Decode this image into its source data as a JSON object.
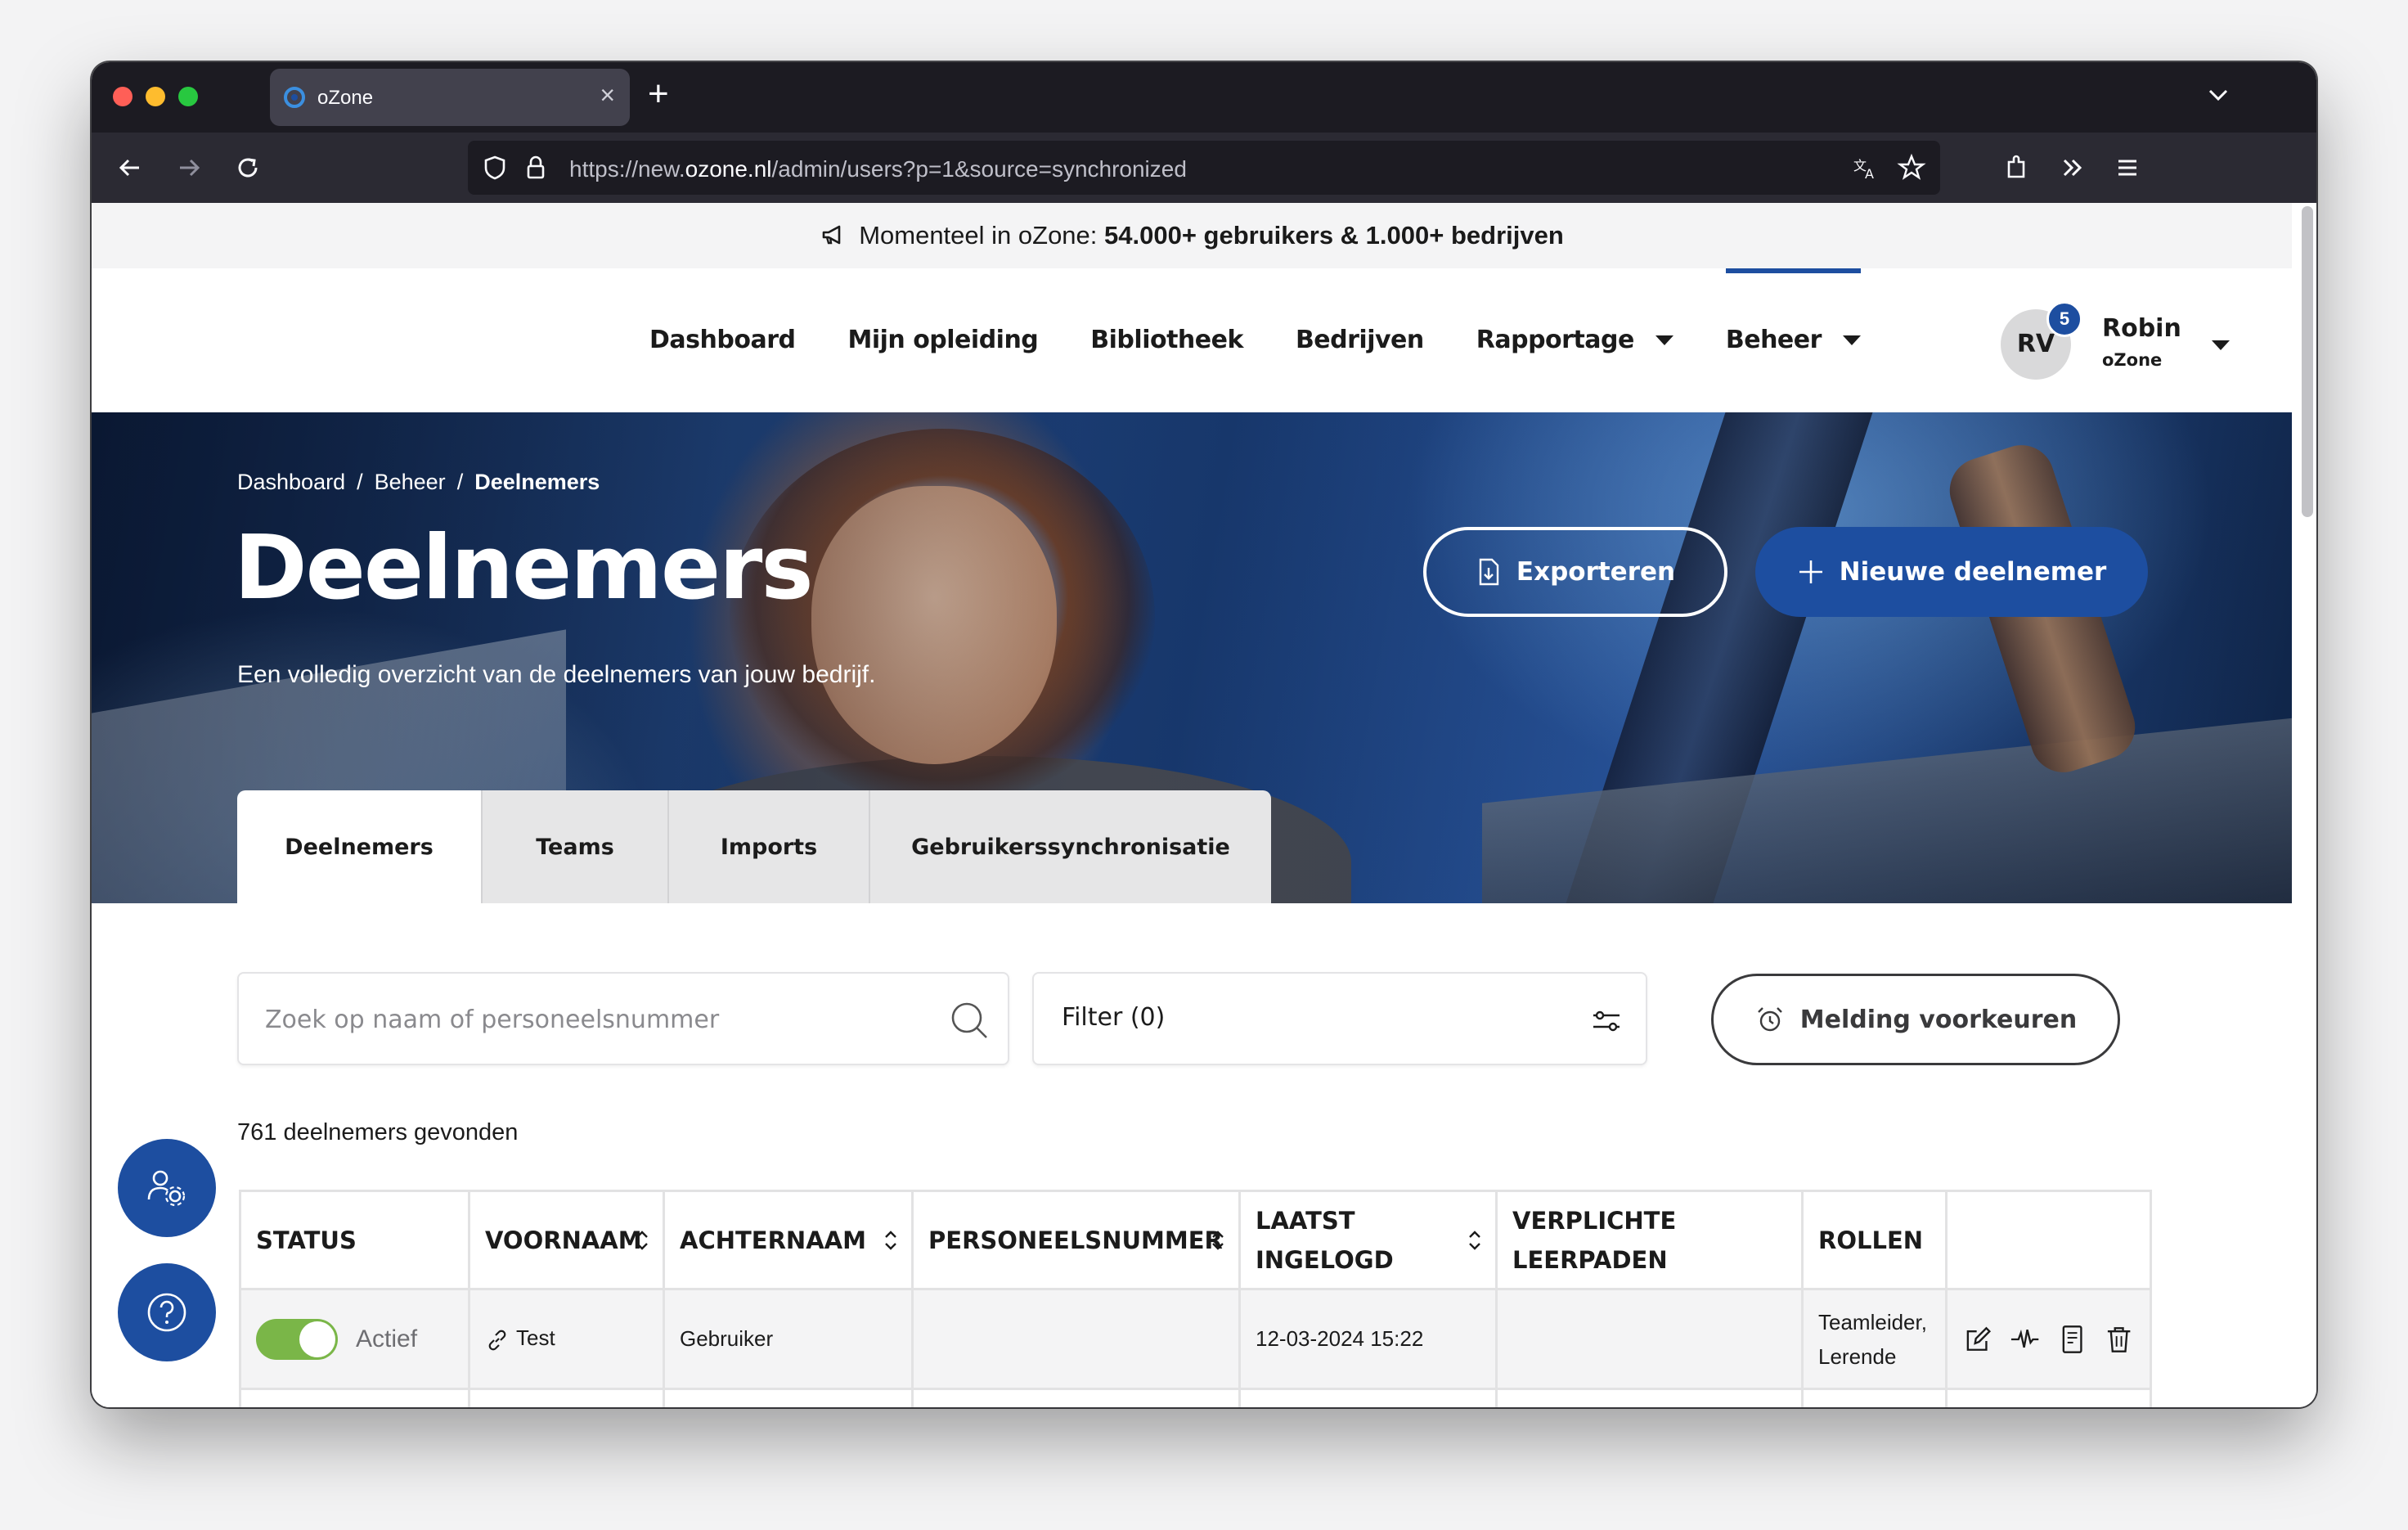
{
  "browser": {
    "tab_title": "oZone",
    "url_prefix": "https://new.",
    "url_host": "ozone.nl",
    "url_path": "/admin/users?p=1&source=synchronized"
  },
  "announcement": {
    "prefix": "Momenteel in oZone: ",
    "highlight": "54.000+ gebruikers & 1.000+ bedrijven"
  },
  "nav": {
    "items": [
      "Dashboard",
      "Mijn opleiding",
      "Bibliotheek",
      "Bedrijven",
      "Rapportage",
      "Beheer"
    ],
    "active": "Beheer"
  },
  "user": {
    "initials": "RV",
    "badge": "5",
    "name": "Robin",
    "org": "oZone"
  },
  "hero": {
    "breadcrumb": [
      "Dashboard",
      "Beheer",
      "Deelnemers"
    ],
    "breadcrumb_sep": "/",
    "title": "Deelnemers",
    "subtitle": "Een volledig overzicht van de deelnemers van jouw bedrijf.",
    "export_label": "Exporteren",
    "new_label": "Nieuwe deelnemer"
  },
  "tabs": [
    {
      "label": "Deelnemers",
      "active": true
    },
    {
      "label": "Teams",
      "active": false
    },
    {
      "label": "Imports",
      "active": false
    },
    {
      "label": "Gebruikerssynchronisatie",
      "active": false
    }
  ],
  "search": {
    "placeholder": "Zoek op naam of personeelsnummer",
    "value": ""
  },
  "filter": {
    "label": "Filter (0)"
  },
  "notify_button": "Melding voorkeuren",
  "result_count": "761 deelnemers gevonden",
  "table": {
    "columns": [
      {
        "line1": "STATUS",
        "line2": "",
        "sortable": false
      },
      {
        "line1": "VOORNAAM",
        "line2": "",
        "sortable": true
      },
      {
        "line1": "ACHTERNAAM",
        "line2": "",
        "sortable": true
      },
      {
        "line1": "PERSONEELSNUMMER",
        "line2": "",
        "sortable": true
      },
      {
        "line1": "LAATST",
        "line2": "INGELOGD",
        "sortable": true
      },
      {
        "line1": "VERPLICHTE",
        "line2": "LEERPADEN",
        "sortable": false
      },
      {
        "line1": "ROLLEN",
        "line2": "",
        "sortable": false
      },
      {
        "line1": "",
        "line2": "",
        "sortable": false
      }
    ],
    "rows": [
      {
        "status": "Actief",
        "active": true,
        "firstname": "Test",
        "lastname": "Gebruiker",
        "employee_no": "",
        "last_login": "12-03-2024 15:22",
        "required_paths": "",
        "roles_line1": "Teamleider,",
        "roles_line2": "Lerende"
      }
    ]
  },
  "colors": {
    "primary": "#1d4ea0",
    "toggle_on": "#7ab648",
    "chrome_dark": "#1c1b22"
  },
  "icons": [
    "megaphone-icon",
    "export-icon",
    "plus-icon",
    "search-icon",
    "sliders-icon",
    "alarm-icon",
    "user-settings-icon",
    "help-icon",
    "link-icon",
    "edit-icon",
    "activity-icon",
    "report-icon",
    "trash-icon"
  ]
}
